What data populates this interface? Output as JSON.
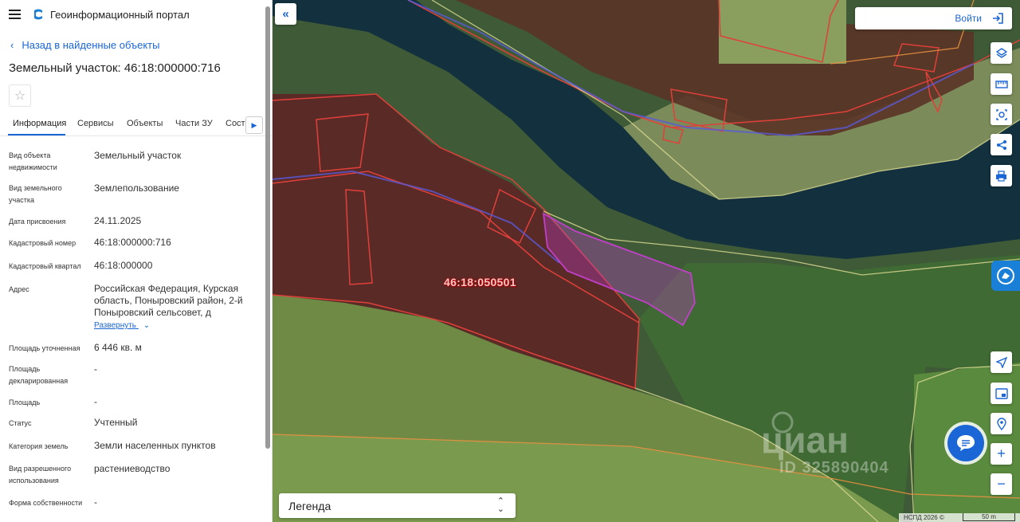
{
  "header": {
    "title": "Геоинформационный портал"
  },
  "nav": {
    "back_label": "Назад в найденные объекты"
  },
  "object": {
    "title": "Земельный участок: 46:18:000000:716"
  },
  "tabs": [
    {
      "label": "Информация"
    },
    {
      "label": "Сервисы"
    },
    {
      "label": "Объекты"
    },
    {
      "label": "Части ЗУ"
    },
    {
      "label": "Соста"
    }
  ],
  "attributes": [
    {
      "label": "Вид объекта недвижимости",
      "value": "Земельный участок"
    },
    {
      "label": "Вид земельного участка",
      "value": "Землепользование"
    },
    {
      "label": "Дата присвоения",
      "value": "24.11.2025"
    },
    {
      "label": "Кадастровый номер",
      "value": "46:18:000000:716"
    },
    {
      "label": "Кадастровый квартал",
      "value": "46:18:000000"
    },
    {
      "label": "Адрес",
      "value": "Российская Федерация, Курская область, Поныровский район, 2-й Поныровский сельсовет, д"
    },
    {
      "label": "Площадь уточненная",
      "value": "6 446 кв. м"
    },
    {
      "label": "Площадь декларированная",
      "value": "-"
    },
    {
      "label": "Площадь",
      "value": "-"
    },
    {
      "label": "Статус",
      "value": "Учтенный"
    },
    {
      "label": "Категория земель",
      "value": "Земли населенных пунктов"
    },
    {
      "label": "Вид разрешенного использования",
      "value": "растениеводство"
    },
    {
      "label": "Форма собственности",
      "value": "-"
    }
  ],
  "expand_label": "Развернуть",
  "map": {
    "login_label": "Войти",
    "cadastral_label": "46:18:050501",
    "legend_label": "Легенда",
    "copyright": "НСПД 2026 ©",
    "scale_label": "50 m",
    "watermark": "циан",
    "watermark_id": "ID 325890404"
  },
  "colors": {
    "accent": "#1a66d6",
    "parcel_red": "#e0403a",
    "selected_parcel": "#c040c8"
  }
}
